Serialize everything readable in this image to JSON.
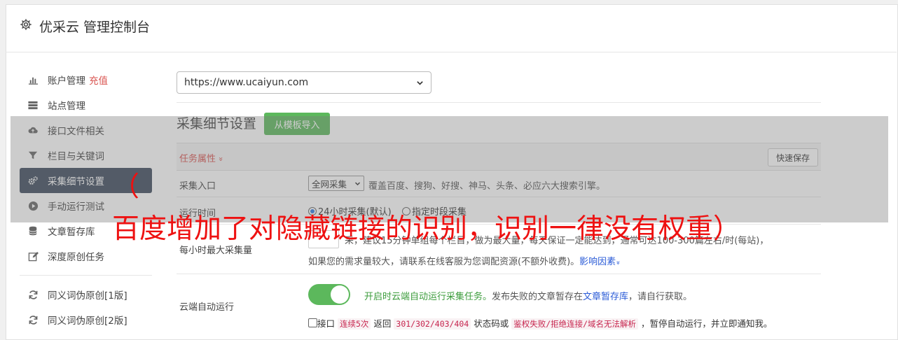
{
  "header": {
    "title": "优采云 管理控制台",
    "icon": "gear-icon"
  },
  "sidebar": {
    "items": [
      {
        "label": "账户管理",
        "extra": "充值",
        "icon": "bar-chart-icon"
      },
      {
        "label": "站点管理",
        "icon": "server-icon"
      },
      {
        "label": "接口文件相关",
        "icon": "cloud-upload-icon"
      },
      {
        "label": "栏目与关键词",
        "icon": "filter-icon"
      },
      {
        "label": "采集细节设置",
        "icon": "gears-icon",
        "active": true
      },
      {
        "label": "手动运行测试",
        "icon": "play-icon"
      },
      {
        "label": "文章暂存库",
        "icon": "database-icon"
      },
      {
        "label": "深度原创任务",
        "icon": "edit-icon"
      },
      {
        "label": "同义词伪原创[1版]",
        "icon": "refresh-icon"
      },
      {
        "label": "同义词伪原创[2版]",
        "icon": "refresh-icon"
      }
    ]
  },
  "site_select": {
    "value": "https://www.ucaiyun.com"
  },
  "section": {
    "title": "采集细节设置",
    "import_button": "从模板导入"
  },
  "task_bar": {
    "label": "任务属性",
    "chevron": "»",
    "quick_save": "快速保存"
  },
  "rows": {
    "entry": {
      "label": "采集入口",
      "select_value": "全网采集",
      "desc": "覆盖百度、搜狗、好搜、神马、头条、必应六大搜索引擎。"
    },
    "runtime": {
      "label": "运行时间",
      "option1": "24小时采集(默认)",
      "option2": "指定时段采集"
    },
    "maxrate": {
      "label": "每小时最大采集量",
      "input_value": "",
      "line1_visible": "采，建议15分钟单组每个栏目，做为最大量，每天保证一定能达到，通常可达100-300篇左右/时(每站)，",
      "line2": "如果您的需求量较大，请联系在线客服为您调配资源(不额外收费)。",
      "line2_link": "影响因素",
      "line2_chevron": "»"
    },
    "cloud": {
      "label": "云端自动运行",
      "toggle_on": true,
      "desc_green": "开启时云端自动运行采集任务。",
      "desc_mid": "发布失败的文章暂存在",
      "desc_link": "文章暂存库",
      "desc_end": "，请自行获取。",
      "check_prefix": "接口",
      "tag1": "连续5次",
      "mid1": " 返回 ",
      "tag2": "301/302/403/404",
      "mid2": " 状态码或 ",
      "tag3": "鉴权失败/拒绝连接/域名无法解析",
      "mid3": " ，暂停自动运行，并立即通知我。"
    }
  },
  "overlay_text": {
    "line1": "（",
    "line2": "百度增加了对隐藏链接的识别，识别一律没有权重）"
  }
}
